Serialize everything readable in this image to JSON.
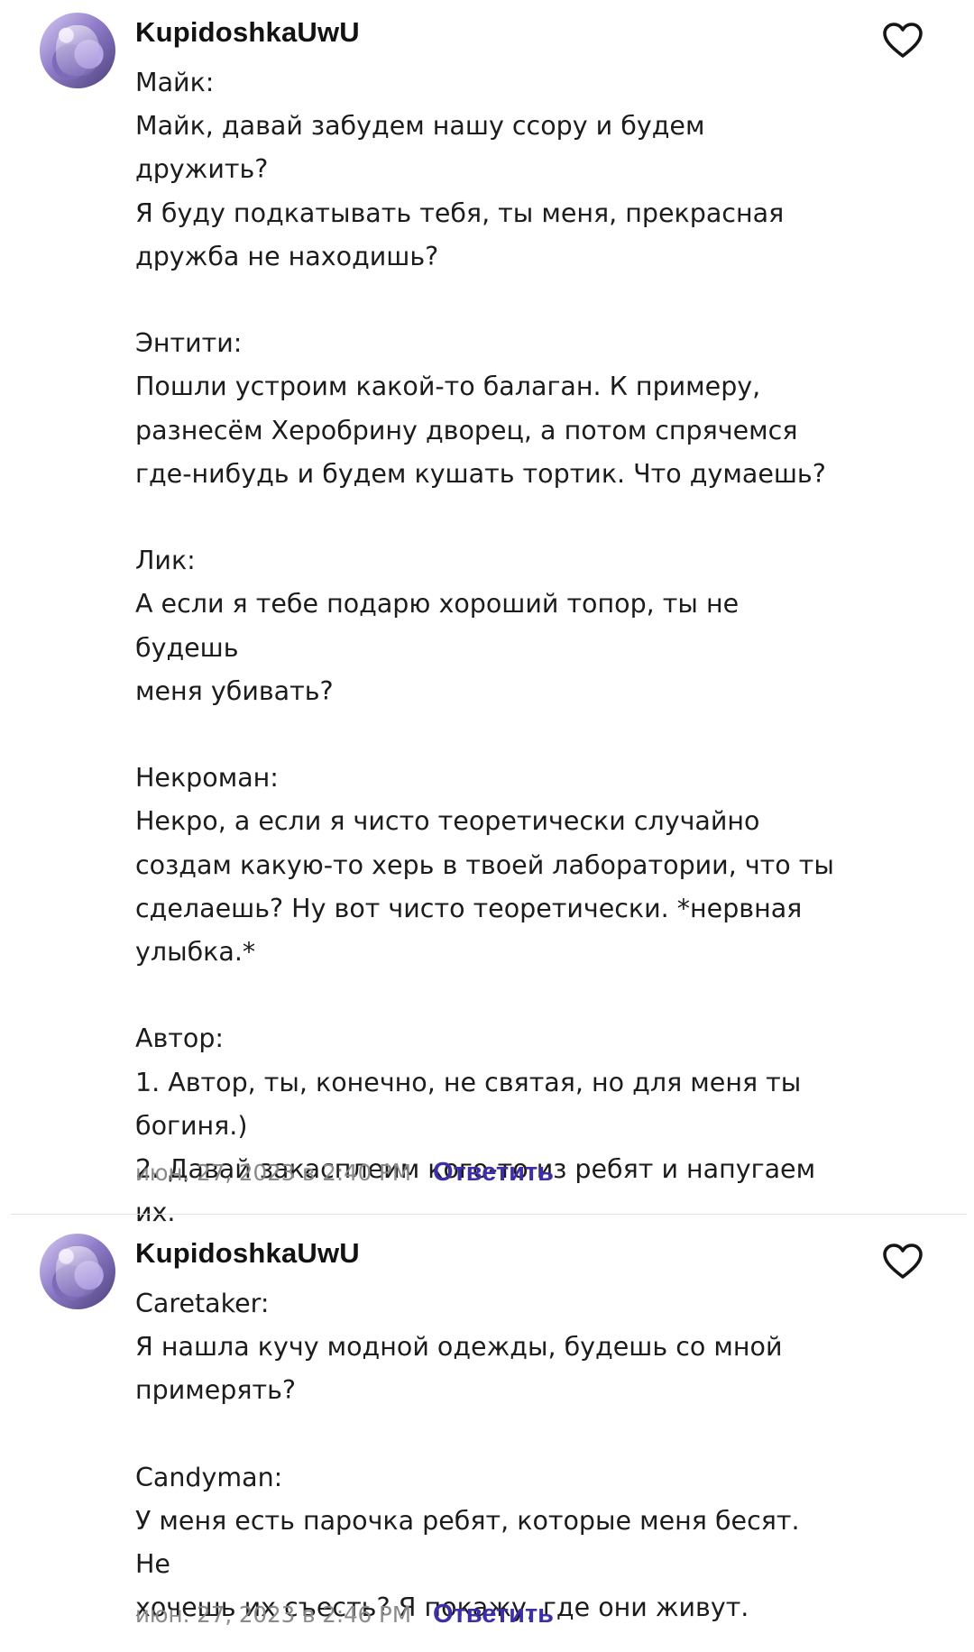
{
  "comments": [
    {
      "username": "KupidoshkaUwU",
      "text": "Майк:\nМайк, давай забудем нашу ссору и будем дружить?\nЯ буду подкатывать тебя, ты меня, прекрасная\nдружба не находишь?\n\nЭнтити:\nПошли устроим какой-то балаган. К примеру,\nразнесём Херобрину дворец, а потом спрячемся\nгде-нибудь и будем кушать тортик. Что думаешь?\n\nЛик:\nА если я тебе подарю хороший топор, ты не будешь\nменя убивать?\n\nНекроман:\nНекро, а если я чисто теоретически случайно\nсоздам какую-то херь в твоей лаборатории, что ты\nсделаешь? Ну вот чисто теоретически. *нервная\nулыбка.*\n\nАвтор:\n1. Автор, ты, конечно, не святая, но для меня ты\nбогиня.)\n2. Давай закасплеим кого-то из ребят и напугаем\nих.",
      "timestamp": "июн. 27, 2023 в 2:40 PM",
      "reply_label": "Ответить"
    },
    {
      "username": "KupidoshkaUwU",
      "text": "Caretaker:\nЯ нашла кучу модной одежды, будешь со мной\nпримерять?\n\nCandyman:\nУ меня есть парочка ребят, которые меня бесят. Не\nхочешь их съесть? Я покажу, где они живут.",
      "timestamp": "июн. 27, 2023 в 2:46 PM",
      "reply_label": "Ответить"
    }
  ],
  "icons": {
    "like": "heart-outline-icon"
  },
  "colors": {
    "accent": "#3c2fa8",
    "meta_text": "#8a8a8a",
    "divider": "#e3e3e3"
  }
}
